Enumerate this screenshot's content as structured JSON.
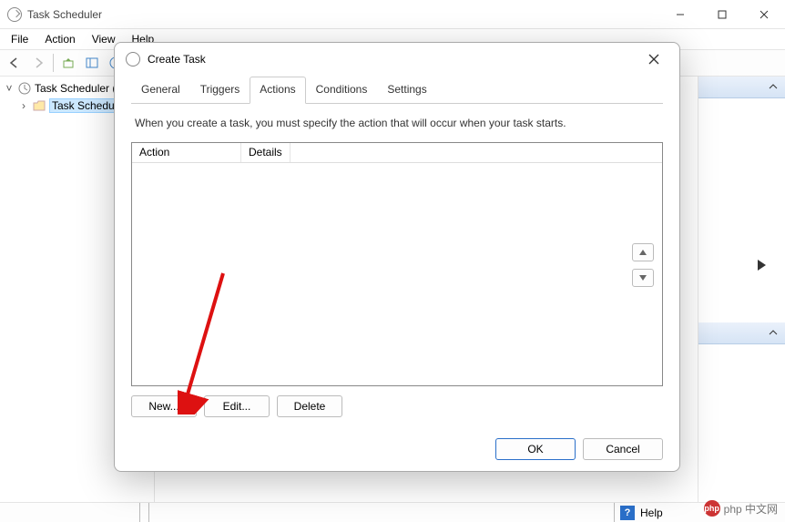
{
  "window": {
    "title": "Task Scheduler",
    "menus": [
      "File",
      "Action",
      "View",
      "Help"
    ]
  },
  "tree": {
    "root": "Task Scheduler (L",
    "child": "Task Schedule"
  },
  "statusbar": {
    "help": "Help"
  },
  "watermark": "php 中文网",
  "dialog": {
    "title": "Create Task",
    "tabs": {
      "general": "General",
      "triggers": "Triggers",
      "actions": "Actions",
      "conditions": "Conditions",
      "settings": "Settings"
    },
    "hint": "When you create a task, you must specify the action that will occur when your task starts.",
    "cols": {
      "action": "Action",
      "details": "Details"
    },
    "buttons": {
      "new": "New...",
      "edit": "Edit...",
      "delete": "Delete",
      "ok": "OK",
      "cancel": "Cancel"
    }
  }
}
